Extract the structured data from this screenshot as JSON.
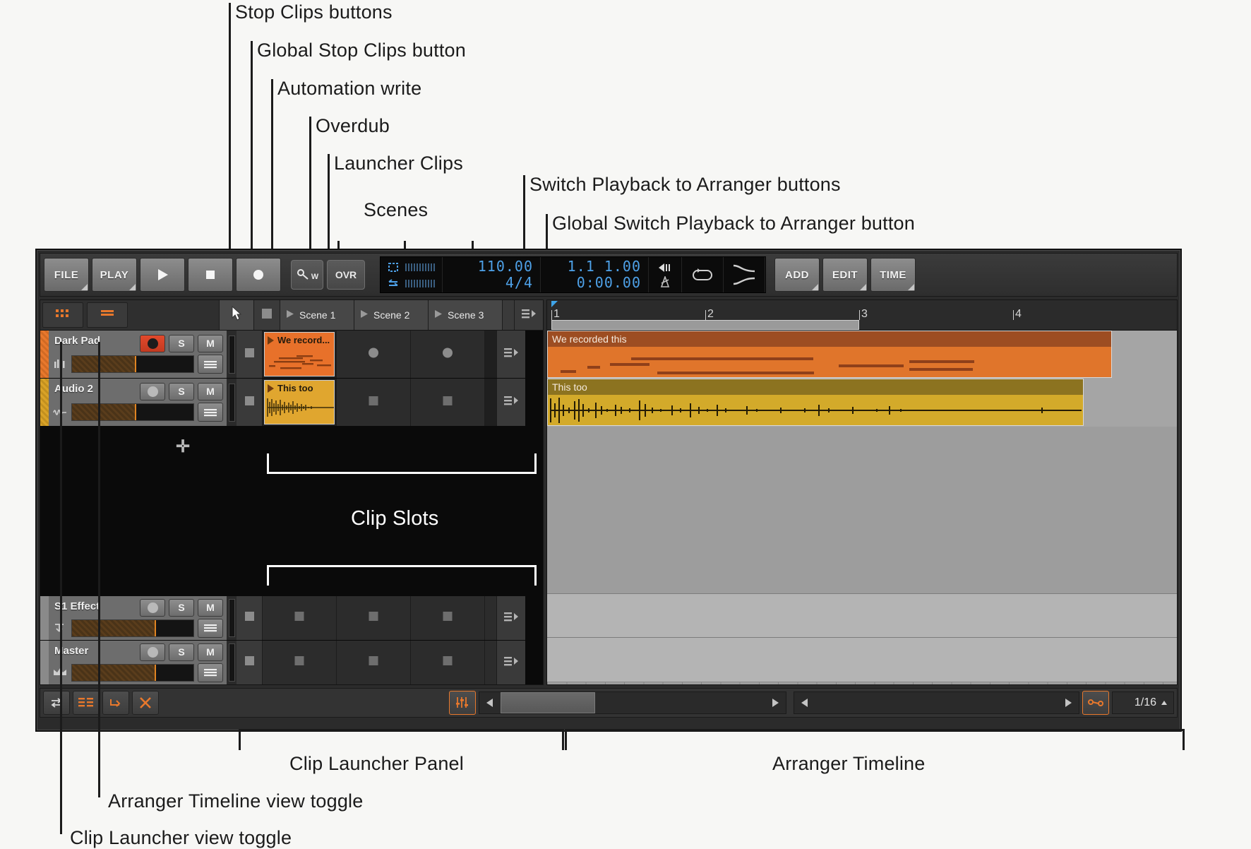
{
  "annotations": {
    "stop_clips": "Stop Clips buttons",
    "global_stop_clips": "Global Stop Clips button",
    "automation_write": "Automation write",
    "overdub": "Overdub",
    "launcher_clips": "Launcher Clips",
    "scenes": "Scenes",
    "switch_playback": "Switch Playback to Arranger buttons",
    "global_switch_playback": "Global Switch Playback to Arranger button",
    "clip_slots": "Clip Slots",
    "clip_launcher_panel": "Clip Launcher Panel",
    "arranger_timeline": "Arranger Timeline",
    "arranger_timeline_toggle": "Arranger Timeline view toggle",
    "clip_launcher_toggle": "Clip Launcher view toggle"
  },
  "transport": {
    "file_label": "FILE",
    "play_label": "PLAY",
    "play_icon": "play-icon",
    "stop_icon": "stop-icon",
    "record_icon": "record-icon",
    "automation_label": "W",
    "overdub_label": "OVR",
    "tempo": "110.00",
    "signature": "4/4",
    "position": "1.1 1.00",
    "time": "0:00.00",
    "add_label": "ADD",
    "edit_label": "EDIT",
    "time_label": "TIME"
  },
  "launcher": {
    "view_toggles": [
      {
        "name": "clip-launcher-view-toggle",
        "icon": "grid-icon"
      },
      {
        "name": "arranger-timeline-view-toggle",
        "icon": "rows-icon"
      }
    ],
    "scenes": [
      {
        "label": "Scene 1"
      },
      {
        "label": "Scene 2"
      },
      {
        "label": "Scene 3"
      }
    ],
    "tracks": [
      {
        "name": "Dark Pad",
        "color": "#e8782c",
        "armed": true,
        "solo": "S",
        "mute": "M",
        "icon": "midi-icon",
        "fader_pct": 52,
        "slots": [
          {
            "state": "clip",
            "label": "We record...",
            "color": "#e8712a",
            "kind": "midi"
          },
          {
            "state": "empty-dot"
          },
          {
            "state": "empty-dot"
          }
        ]
      },
      {
        "name": "Audio 2",
        "color": "#d9a227",
        "armed": false,
        "solo": "S",
        "mute": "M",
        "icon": "audio-icon",
        "fader_pct": 52,
        "slots": [
          {
            "state": "clip",
            "label": "This too",
            "color": "#e0a62f",
            "kind": "audio"
          },
          {
            "state": "empty-square"
          },
          {
            "state": "empty-square"
          }
        ]
      }
    ],
    "bottom_tracks": [
      {
        "name": "S1 Effect",
        "solo": "S",
        "mute": "M",
        "icon": "send-icon",
        "fader_pct": 68
      },
      {
        "name": "Master",
        "solo": "S",
        "mute": "M",
        "icon": "crown-icon",
        "fader_pct": 68
      }
    ],
    "add_track_icon": "plus-icon"
  },
  "arranger": {
    "ruler_marks": [
      "1",
      "2",
      "3",
      "4"
    ],
    "loop_region": {
      "start": "1",
      "end": "3"
    },
    "clips": [
      {
        "label": "We recorded this",
        "color": "#e0752b",
        "header_color": "#9d4d22",
        "kind": "midi"
      },
      {
        "label": "This too",
        "color": "#d3aa2a",
        "header_color": "#8c7320",
        "kind": "audio"
      }
    ]
  },
  "bottom_toolbar": {
    "tools": [
      {
        "name": "toggle-io-icon",
        "icon": "arrows-icon"
      },
      {
        "name": "list-view-icon",
        "icon": "list-icon"
      },
      {
        "name": "automation-icon",
        "icon": "curve-icon"
      },
      {
        "name": "delete-icon",
        "icon": "x-icon"
      },
      {
        "name": "mixer-icon",
        "icon": "sliders-icon"
      }
    ],
    "grid_value": "1/16",
    "link_icon": "link-icon"
  },
  "colors": {
    "accent_orange": "#e8782c",
    "accent_blue": "#4ea1e8",
    "record_red": "#e2492c"
  }
}
